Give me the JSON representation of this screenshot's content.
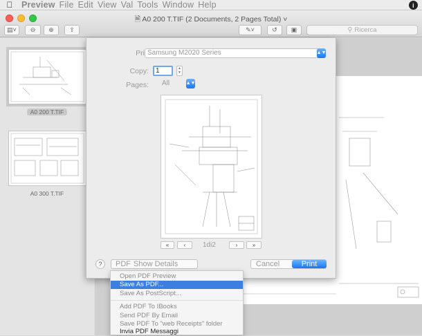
{
  "menubar": {
    "items": [
      "Preview",
      "File",
      "Edit",
      "View",
      "Val",
      "Tools",
      "Window",
      "Help"
    ],
    "apple_icon": "apple-icon",
    "status_icon": "info-icon"
  },
  "window": {
    "title": "A0  200  T.TIF (2 Documents, 2 Pages Total)",
    "search_placeholder": "Ricerca"
  },
  "sidebar": {
    "thumbnails": [
      {
        "label": "A0  200  T.TIF",
        "selected": true
      },
      {
        "label": "A0  300  T.TIF",
        "selected": false
      }
    ]
  },
  "print_dialog": {
    "printer_label": "Printer:",
    "printer_value": "Samsung M2020 Series",
    "copies_label": "Copy:",
    "copies_value": "1",
    "pages_label": "Pages:",
    "pages_value": "All",
    "page_indicator": "1di2",
    "nav": {
      "first": "«",
      "prev": "‹",
      "next": "›",
      "last": "»"
    },
    "help_label": "?",
    "pdf_label": "PDF",
    "show_details_label": "Show Details",
    "cancel_label": "Cancel",
    "print_label": "Print"
  },
  "pdf_menu": {
    "items": [
      {
        "label": "Open PDF Preview",
        "highlight": false,
        "dark": false
      },
      {
        "label": "Save As PDF...",
        "highlight": true,
        "dark": false
      },
      {
        "label": "Save As PostScript...",
        "highlight": false,
        "dark": false
      },
      {
        "label": "Add PDF To IBooks",
        "highlight": false,
        "dark": false
      },
      {
        "label": "Send PDF By Email",
        "highlight": false,
        "dark": false
      },
      {
        "label": "Save PDF To \"web Receipts\" folder",
        "highlight": false,
        "dark": false
      },
      {
        "label": "Invia PDF Messaggi",
        "highlight": false,
        "dark": true
      }
    ]
  },
  "colors": {
    "accent": "#1877f2",
    "highlight": "#3d7fe0"
  }
}
